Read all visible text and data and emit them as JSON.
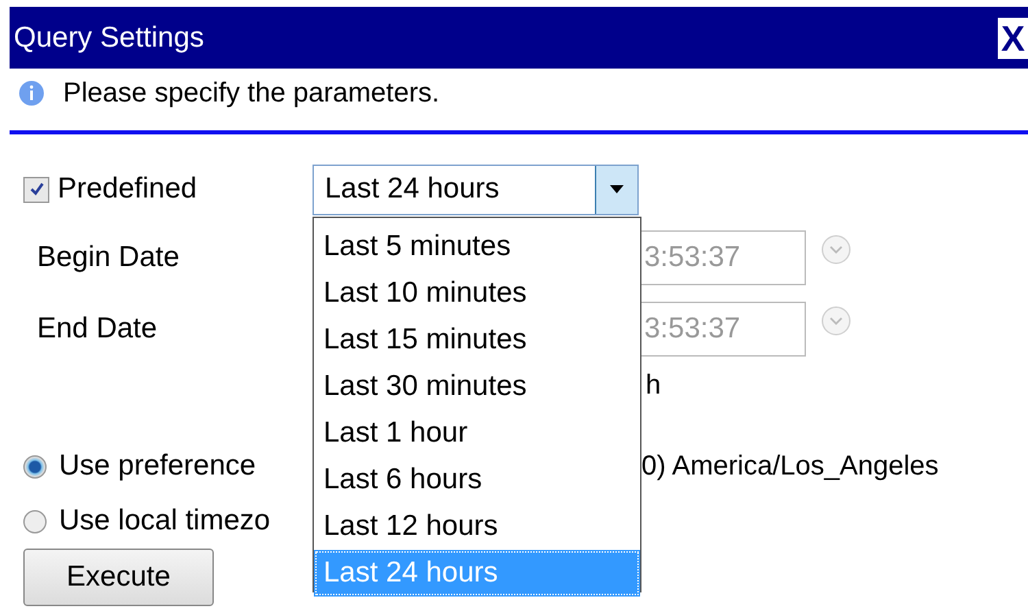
{
  "window": {
    "title": "Query Settings",
    "close": "X"
  },
  "info": "Please specify the parameters.",
  "predefined": {
    "label": "Predefined",
    "checked": true,
    "value": "Last 24 hours",
    "options": [
      {
        "label": "Last 5 minutes",
        "selected": false
      },
      {
        "label": "Last 10 minutes",
        "selected": false
      },
      {
        "label": "Last 15 minutes",
        "selected": false
      },
      {
        "label": "Last 30 minutes",
        "selected": false
      },
      {
        "label": "Last 1 hour",
        "selected": false
      },
      {
        "label": "Last 6 hours",
        "selected": false
      },
      {
        "label": "Last 12 hours",
        "selected": false
      },
      {
        "label": "Last 24 hours",
        "selected": true
      }
    ]
  },
  "begin_date": {
    "label": "Begin Date",
    "value": "3:53:37"
  },
  "end_date": {
    "label": "End Date",
    "value": "3:53:37"
  },
  "row_fragment": "h",
  "timezones": [
    {
      "label": "Use preference",
      "detail": "0) America/Los_Angeles",
      "selected": true
    },
    {
      "label": "Use local timezo",
      "selected": false
    }
  ],
  "execute": "Execute"
}
